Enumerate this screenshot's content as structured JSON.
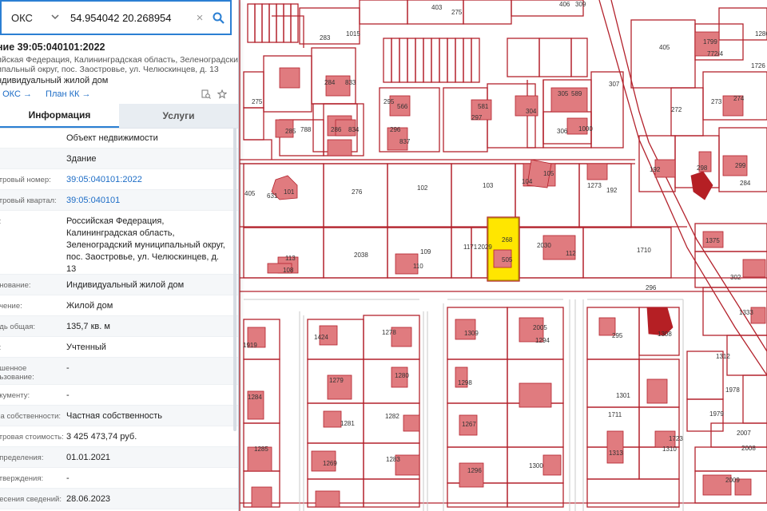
{
  "search": {
    "type_label": "ОКС",
    "value": "54.954042 20.268954",
    "clear_symbol": "×"
  },
  "object": {
    "title": "ние 39:05:040101:2022",
    "address_lines": [
      "ийская Федерация, Калининградская область, Зеленоградский",
      "ипальный округ, пос. Заостровье, ул. Челюскинцев, д. 13"
    ],
    "kind": "ндивидуальный жилой дом"
  },
  "links": {
    "plan_oks": "н ОКС →",
    "plan_kk": "План КК →"
  },
  "tabs": {
    "info": "Информация",
    "services": "Услуги"
  },
  "rows": [
    {
      "label": "",
      "value": "Объект недвижимости"
    },
    {
      "label": "",
      "value": "Здание"
    },
    {
      "label": "стровый номер:",
      "value": "39:05:040101:2022",
      "link": true
    },
    {
      "label": "стровый квартал:",
      "value": "39:05:040101",
      "link": true
    },
    {
      "label": "с:",
      "value": "Российская Федерация, Калининградская область, Зеленоградский муниципальный округ, пос. Заостровье, ул. Челюскинцев, д. 13"
    },
    {
      "label": "енование:",
      "value": "Индивидуальный жилой дом"
    },
    {
      "label": "ачение:",
      "value": "Жилой дом"
    },
    {
      "label": "адь общая:",
      "value": "135,7 кв. м"
    },
    {
      "label": "с:",
      "value": "Учтенный"
    },
    {
      "label": "ешенное\nльзование:",
      "value": "-"
    },
    {
      "label": "окументу:",
      "value": "-"
    },
    {
      "label": "ма собственности:",
      "value": "Частная собственность"
    },
    {
      "label": "стровая стоимость:",
      "value": "3 425 473,74 руб."
    },
    {
      "label": "определения:",
      "value": "01.01.2021"
    },
    {
      "label": "утверждения:",
      "value": "-"
    },
    {
      "label": "несения сведений:",
      "value": "28.06.2023"
    }
  ],
  "map_labels": {
    "parcels": [
      "403",
      "275",
      "406",
      "309",
      "405",
      "283",
      "1015",
      "284",
      "833",
      "307",
      "272",
      "273",
      "274",
      "1286",
      "305",
      "589",
      "304",
      "581",
      "297",
      "295",
      "566",
      "296",
      "837",
      "286",
      "834",
      "285",
      "788",
      "306",
      "1000",
      "275",
      "631",
      "101",
      "276",
      "102",
      "103",
      "104",
      "105",
      "1273",
      "192",
      "192",
      "298",
      "299",
      "284",
      "2038",
      "109",
      "110",
      "1171",
      "2029",
      "2030",
      "112",
      "1710",
      "113",
      "108",
      "1375",
      "302",
      "296",
      "1333",
      "295",
      "1308",
      "1309",
      "1294",
      "1424",
      "1278",
      "1279",
      "1280",
      "1281",
      "1282",
      "1283",
      "1285",
      "1269",
      "1284",
      "1267",
      "1298",
      "1296",
      "1300",
      "1301",
      "1310",
      "1313",
      "1312",
      "1978",
      "1979",
      "2007",
      "2008",
      "2009",
      "2005",
      "1711",
      "1723",
      "1726",
      "1799",
      "772/4",
      "405",
      "268",
      "505",
      "1919",
      "2028",
      "2022",
      "265"
    ]
  },
  "colors": {
    "parcel_line": "#b3222c",
    "building_fill": "#e07b7f",
    "building_stroke": "#b3222c",
    "selected_fill": "#ffe600",
    "selected_stroke": "#b59b00",
    "dark_building": "#b51f24",
    "road_line": "#c8c8c8",
    "accent": "#2b7fd3",
    "link": "#1c6cc6"
  }
}
